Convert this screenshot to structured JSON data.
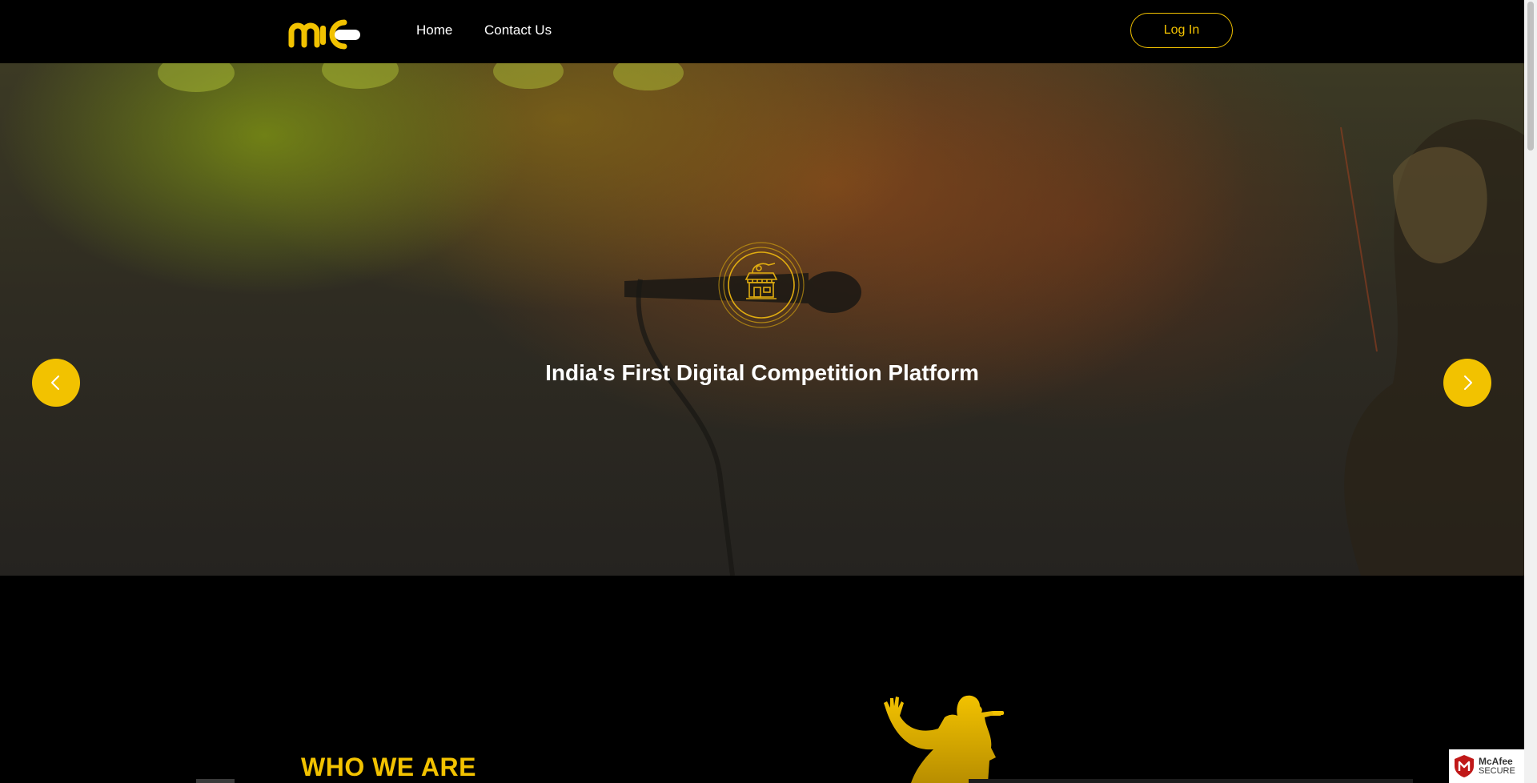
{
  "nav": {
    "home_label": "Home",
    "contact_label": "Contact Us",
    "login_label": "Log In",
    "logo_text": "mic"
  },
  "hero": {
    "title": "India's First Digital Competition Platform"
  },
  "about": {
    "title": "WHO WE ARE"
  },
  "badge": {
    "brand": "McAfee",
    "label": "SECURE"
  },
  "colors": {
    "accent": "#f2c200",
    "background": "#000000"
  },
  "icons": {
    "prev": "chevron-left-icon",
    "next": "chevron-right-icon",
    "emblem": "market-stall-icon",
    "badge": "mcafee-shield-icon"
  }
}
